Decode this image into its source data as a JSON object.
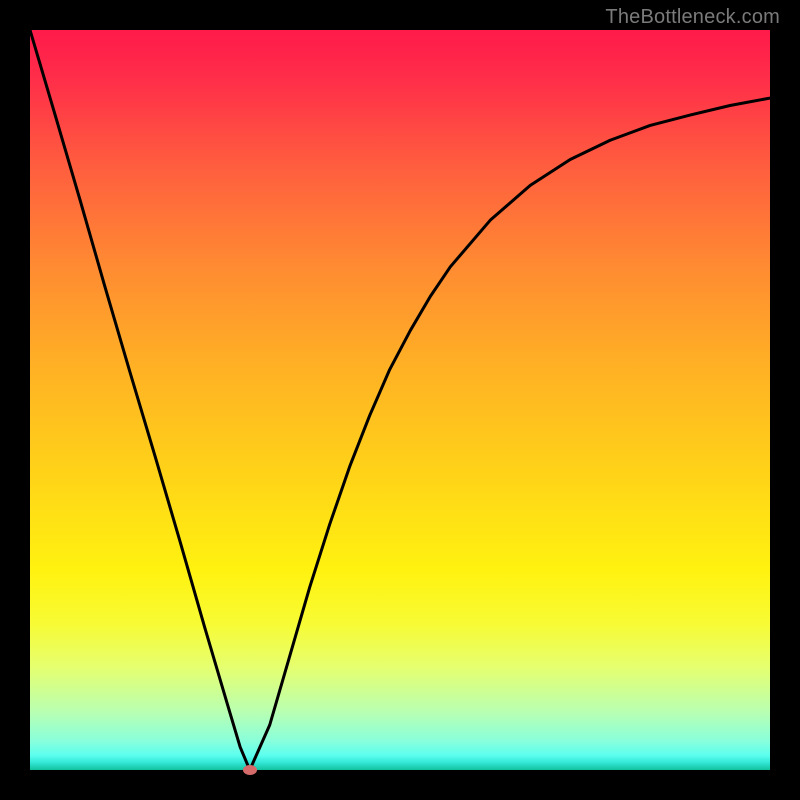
{
  "watermark": "TheBottleneck.com",
  "chart_data": {
    "type": "line",
    "title": "",
    "xlabel": "",
    "ylabel": "",
    "xlim": [
      0,
      1
    ],
    "ylim": [
      0,
      1
    ],
    "series": [
      {
        "name": "curve",
        "x": [
          0.0,
          0.034,
          0.068,
          0.101,
          0.135,
          0.169,
          0.203,
          0.236,
          0.27,
          0.284,
          0.297,
          0.324,
          0.351,
          0.378,
          0.405,
          0.432,
          0.459,
          0.486,
          0.514,
          0.541,
          0.568,
          0.622,
          0.676,
          0.73,
          0.784,
          0.838,
          0.892,
          0.946,
          1.0
        ],
        "y": [
          1.0,
          0.885,
          0.769,
          0.654,
          0.538,
          0.424,
          0.308,
          0.193,
          0.078,
          0.031,
          0.0,
          0.061,
          0.154,
          0.247,
          0.332,
          0.41,
          0.479,
          0.541,
          0.594,
          0.64,
          0.68,
          0.743,
          0.79,
          0.825,
          0.851,
          0.871,
          0.885,
          0.898,
          0.908
        ]
      }
    ],
    "marker": {
      "x": 0.297,
      "y": 0.0
    },
    "background_gradient": {
      "top": "#ff1a4a",
      "mid_top": "#ff8b32",
      "mid": "#ffd318",
      "mid_bottom": "#fff210",
      "bottom": "#12c29c"
    }
  }
}
